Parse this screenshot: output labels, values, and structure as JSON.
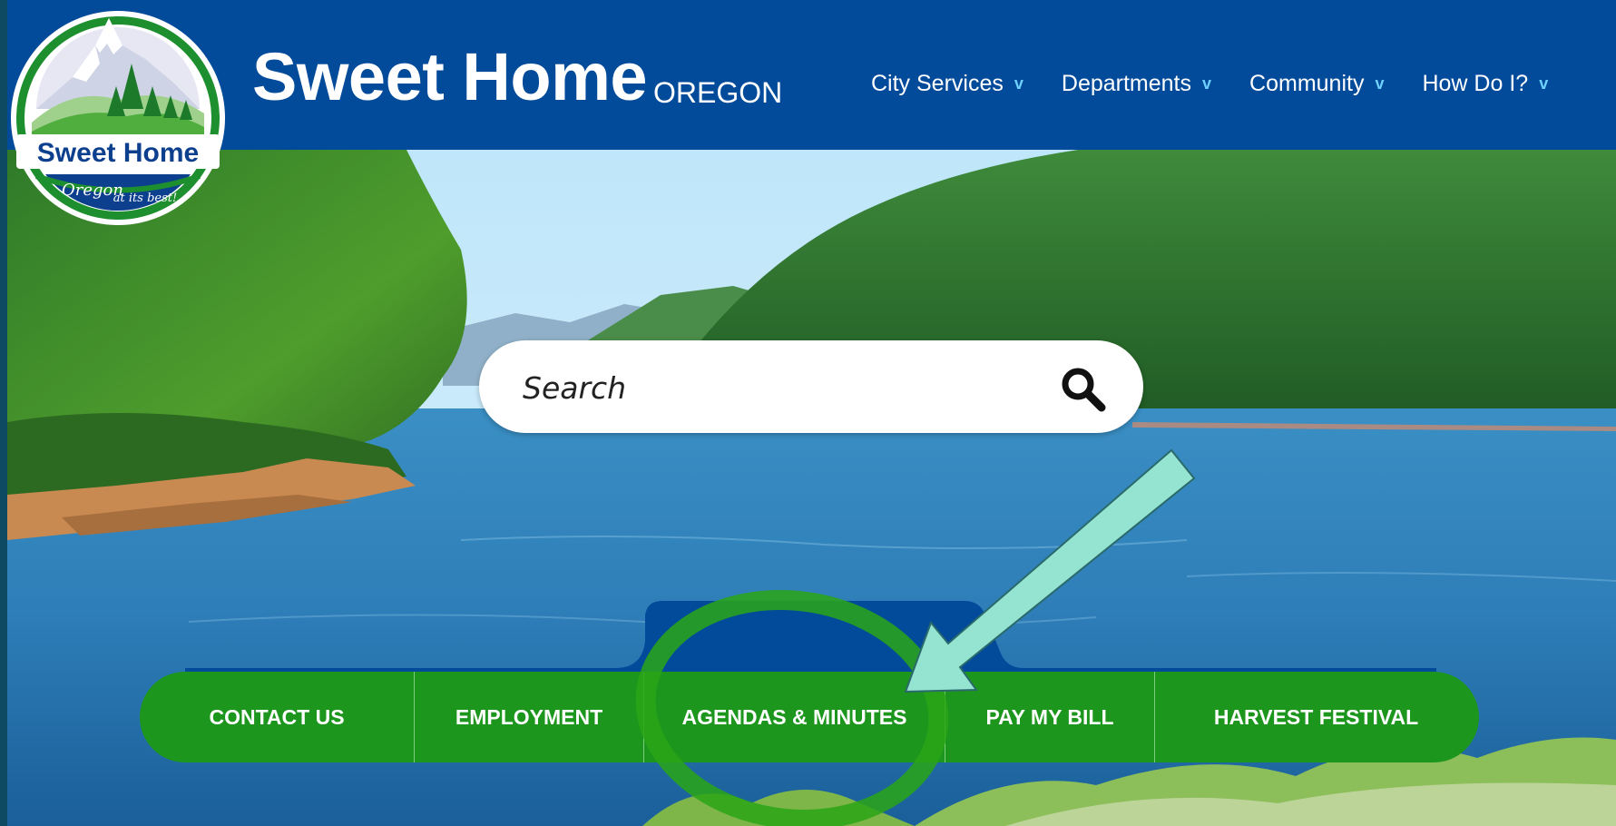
{
  "header": {
    "title": "Sweet Home",
    "subtitle": "OREGON",
    "nav": [
      {
        "label": "City Services"
      },
      {
        "label": "Departments"
      },
      {
        "label": "Community"
      },
      {
        "label": "How Do I?"
      }
    ]
  },
  "logo": {
    "line1": "Sweet Home",
    "line2": "Oregon",
    "line3": "at its best!"
  },
  "search": {
    "placeholder": "Search"
  },
  "tagline": "OREGON at its be",
  "quick_links": [
    {
      "label": "CONTACT US"
    },
    {
      "label": "EMPLOYMENT"
    },
    {
      "label": "AGENDAS & MINUTES"
    },
    {
      "label": "PAY MY BILL"
    },
    {
      "label": "HARVEST FESTIVAL"
    }
  ],
  "colors": {
    "header_bg": "#024a9a",
    "quick_bar": "#1d961d",
    "tagline_text": "#f6f22a",
    "arrow": "#95e4d2",
    "circle": "#2aa616"
  }
}
